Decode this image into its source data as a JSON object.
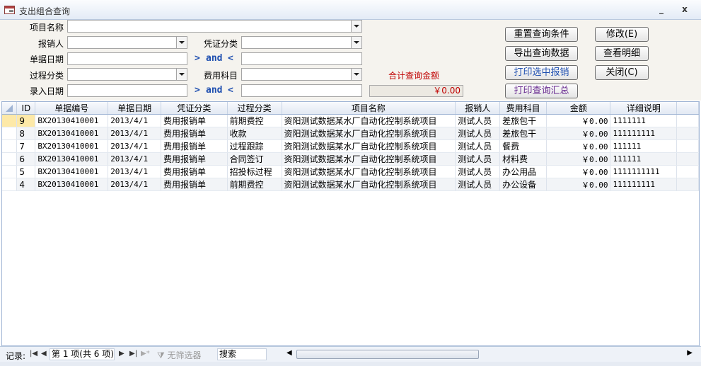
{
  "window": {
    "title": "支出组合查询",
    "minimize": "_",
    "close": "x"
  },
  "form": {
    "project_name_label": "项目名称",
    "reimburser_label": "报销人",
    "voucher_type_label": "凭证分类",
    "doc_date_label": "单据日期",
    "process_type_label": "过程分类",
    "expense_item_label": "费用科目",
    "entry_date_label": "录入日期",
    "gt": ">",
    "and": "and",
    "lt": "<",
    "total_label": "合计查询金额",
    "total_value": "￥0.00"
  },
  "buttons": {
    "reset": "重置查询条件",
    "modify": "修改(E)",
    "export": "导出查询数据",
    "detail": "查看明细",
    "print_selected": "打印选中报销",
    "close": "关闭(C)",
    "print_summary": "打印查询汇总"
  },
  "grid": {
    "columns": [
      "ID",
      "单据编号",
      "单据日期",
      "凭证分类",
      "过程分类",
      "项目名称",
      "报销人",
      "费用科目",
      "金额",
      "详细说明"
    ],
    "rows": [
      [
        "9",
        "BX20130410001",
        "2013/4/1",
        "费用报销单",
        "前期费控",
        "资阳测试数据某水厂自动化控制系统项目",
        "测试人员",
        "差旅包干",
        "￥0.00",
        "1111111"
      ],
      [
        "8",
        "BX20130410001",
        "2013/4/1",
        "费用报销单",
        "收款",
        "资阳测试数据某水厂自动化控制系统项目",
        "测试人员",
        "差旅包干",
        "￥0.00",
        "111111111"
      ],
      [
        "7",
        "BX20130410001",
        "2013/4/1",
        "费用报销单",
        "过程跟踪",
        "资阳测试数据某水厂自动化控制系统项目",
        "测试人员",
        "餐费",
        "￥0.00",
        "111111"
      ],
      [
        "6",
        "BX20130410001",
        "2013/4/1",
        "费用报销单",
        "合同签订",
        "资阳测试数据某水厂自动化控制系统项目",
        "测试人员",
        "材料费",
        "￥0.00",
        "111111"
      ],
      [
        "5",
        "BX20130410001",
        "2013/4/1",
        "费用报销单",
        "招投标过程",
        "资阳测试数据某水厂自动化控制系统项目",
        "测试人员",
        "办公用品",
        "￥0.00",
        "1111111111"
      ],
      [
        "4",
        "BX20130410001",
        "2013/4/1",
        "费用报销单",
        "前期费控",
        "资阳测试数据某水厂自动化控制系统项目",
        "测试人员",
        "办公设备",
        "￥0.00",
        "111111111"
      ]
    ]
  },
  "navbar": {
    "record_label": "记录:",
    "record_value": "第 1 项(共 6 项)",
    "no_filter": "无筛选器",
    "search_label": "搜索"
  }
}
